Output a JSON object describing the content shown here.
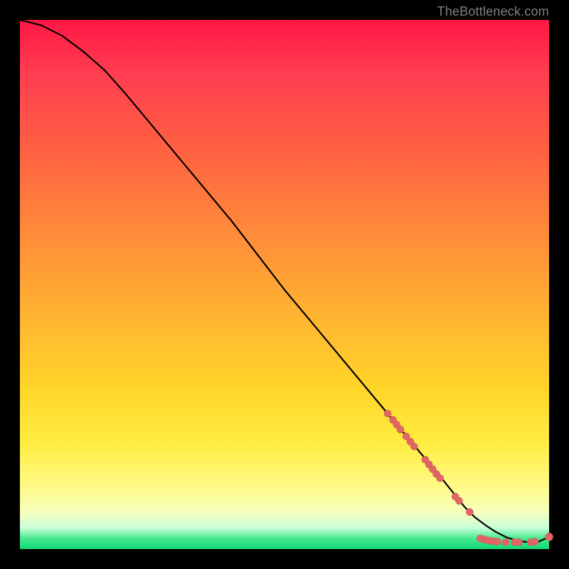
{
  "watermark": "TheBottleneck.com",
  "colors": {
    "background": "#000000",
    "curve": "#000000",
    "marker_fill": "#e06666",
    "marker_stroke": "#d45a5a"
  },
  "chart_data": {
    "type": "line",
    "title": "",
    "xlabel": "",
    "ylabel": "",
    "xlim": [
      0,
      100
    ],
    "ylim": [
      0,
      100
    ],
    "series": [
      {
        "name": "curve",
        "x": [
          0,
          4,
          8,
          12,
          16,
          20,
          25,
          30,
          35,
          40,
          45,
          50,
          55,
          60,
          65,
          70,
          75,
          80,
          84,
          86,
          88,
          90,
          92,
          94,
          96,
          98,
          100
        ],
        "values": [
          100,
          99,
          97,
          94,
          90.5,
          86,
          80,
          74,
          68,
          62,
          55.5,
          49,
          43,
          37,
          31,
          25,
          19,
          13,
          8,
          6,
          4.5,
          3.2,
          2.2,
          1.6,
          1.3,
          1.4,
          2.3
        ]
      }
    ],
    "markers": [
      {
        "x": 69.5,
        "y": 25.6,
        "r": 5
      },
      {
        "x": 70.5,
        "y": 24.4,
        "r": 5
      },
      {
        "x": 71.2,
        "y": 23.5,
        "r": 5
      },
      {
        "x": 71.9,
        "y": 22.6,
        "r": 5
      },
      {
        "x": 73.0,
        "y": 21.3,
        "r": 5
      },
      {
        "x": 73.8,
        "y": 20.3,
        "r": 5
      },
      {
        "x": 74.5,
        "y": 19.4,
        "r": 5
      },
      {
        "x": 76.6,
        "y": 16.9,
        "r": 5
      },
      {
        "x": 77.3,
        "y": 16.0,
        "r": 5
      },
      {
        "x": 78.0,
        "y": 15.1,
        "r": 5
      },
      {
        "x": 78.7,
        "y": 14.2,
        "r": 5
      },
      {
        "x": 79.4,
        "y": 13.4,
        "r": 5
      },
      {
        "x": 82.3,
        "y": 9.9,
        "r": 5
      },
      {
        "x": 83.0,
        "y": 9.1,
        "r": 5
      },
      {
        "x": 85.0,
        "y": 7.0,
        "r": 5
      },
      {
        "x": 87.0,
        "y": 2.0,
        "r": 5
      },
      {
        "x": 87.8,
        "y": 1.8,
        "r": 5
      },
      {
        "x": 88.6,
        "y": 1.6,
        "r": 5
      },
      {
        "x": 89.4,
        "y": 1.5,
        "r": 5
      },
      {
        "x": 90.2,
        "y": 1.4,
        "r": 5
      },
      {
        "x": 91.8,
        "y": 1.3,
        "r": 5
      },
      {
        "x": 93.5,
        "y": 1.3,
        "r": 5
      },
      {
        "x": 94.3,
        "y": 1.3,
        "r": 5
      },
      {
        "x": 96.5,
        "y": 1.3,
        "r": 5
      },
      {
        "x": 97.3,
        "y": 1.4,
        "r": 5
      },
      {
        "x": 100.0,
        "y": 2.3,
        "r": 5.5
      }
    ]
  }
}
